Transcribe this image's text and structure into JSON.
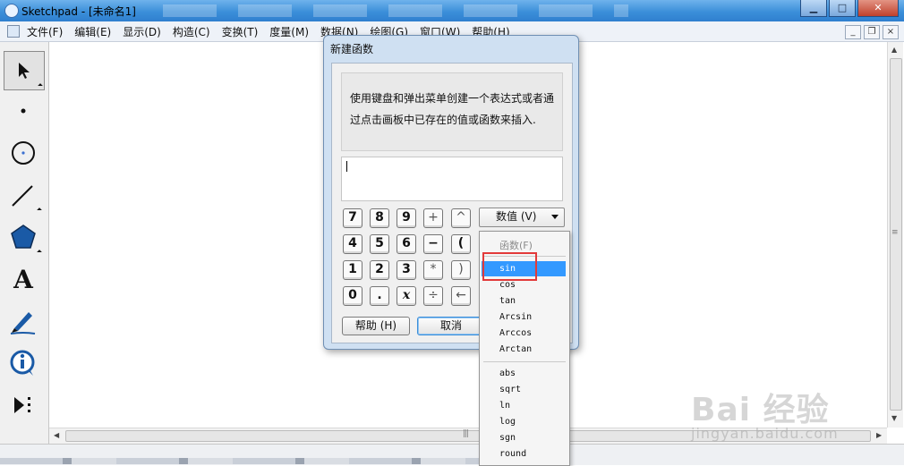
{
  "window": {
    "title": "Sketchpad   - [未命名1]",
    "controls": {
      "minimize": "▁",
      "maximize": "□",
      "close": "✕"
    }
  },
  "menubar": {
    "items": [
      "文件(F)",
      "编辑(E)",
      "显示(D)",
      "构造(C)",
      "变换(T)",
      "度量(M)",
      "数据(N)",
      "绘图(G)",
      "窗口(W)",
      "帮助(H)"
    ],
    "doc_controls": {
      "minimize": "_",
      "restore": "❐",
      "close": "×"
    }
  },
  "toolbox": {
    "tools": [
      {
        "name": "arrow-tool",
        "icon": "arrow-select-icon",
        "selected": true
      },
      {
        "name": "point-tool",
        "icon": "point-icon"
      },
      {
        "name": "compass-tool",
        "icon": "circle-icon"
      },
      {
        "name": "straightedge-tool",
        "icon": "line-segment-icon"
      },
      {
        "name": "polygon-tool",
        "icon": "pentagon-icon"
      },
      {
        "name": "text-tool",
        "icon": "text-a-icon",
        "glyph": "A"
      },
      {
        "name": "marker-tool",
        "icon": "marker-pen-icon"
      },
      {
        "name": "information-tool",
        "icon": "info-icon",
        "glyph": "i"
      },
      {
        "name": "custom-tool",
        "icon": "custom-tool-icon"
      }
    ]
  },
  "dialog": {
    "title": "新建函数",
    "instructions": "使用键盘和弹出菜单创建一个表达式或者通过点击画板中已存在的值或函数来插入.",
    "expression": "",
    "keypad": [
      [
        "7",
        "8",
        "9",
        "+",
        "^"
      ],
      [
        "4",
        "5",
        "6",
        "−",
        "("
      ],
      [
        "1",
        "2",
        "3",
        "*",
        ")"
      ],
      [
        "0",
        ".",
        "x",
        "÷",
        "←"
      ]
    ],
    "values_button": "数值 (V)",
    "help_button": "帮助 (H)",
    "cancel_button": "取消"
  },
  "function_menu": {
    "header": "函数(F)",
    "items": [
      "sin",
      "cos",
      "tan",
      "Arcsin",
      "Arccos",
      "Arctan"
    ],
    "items2": [
      "abs",
      "sqrt",
      "ln",
      "log",
      "sgn",
      "round"
    ],
    "highlighted": "sin"
  },
  "watermark": {
    "brand": "Bai 经验",
    "url": "jingyan.baidu.com"
  }
}
